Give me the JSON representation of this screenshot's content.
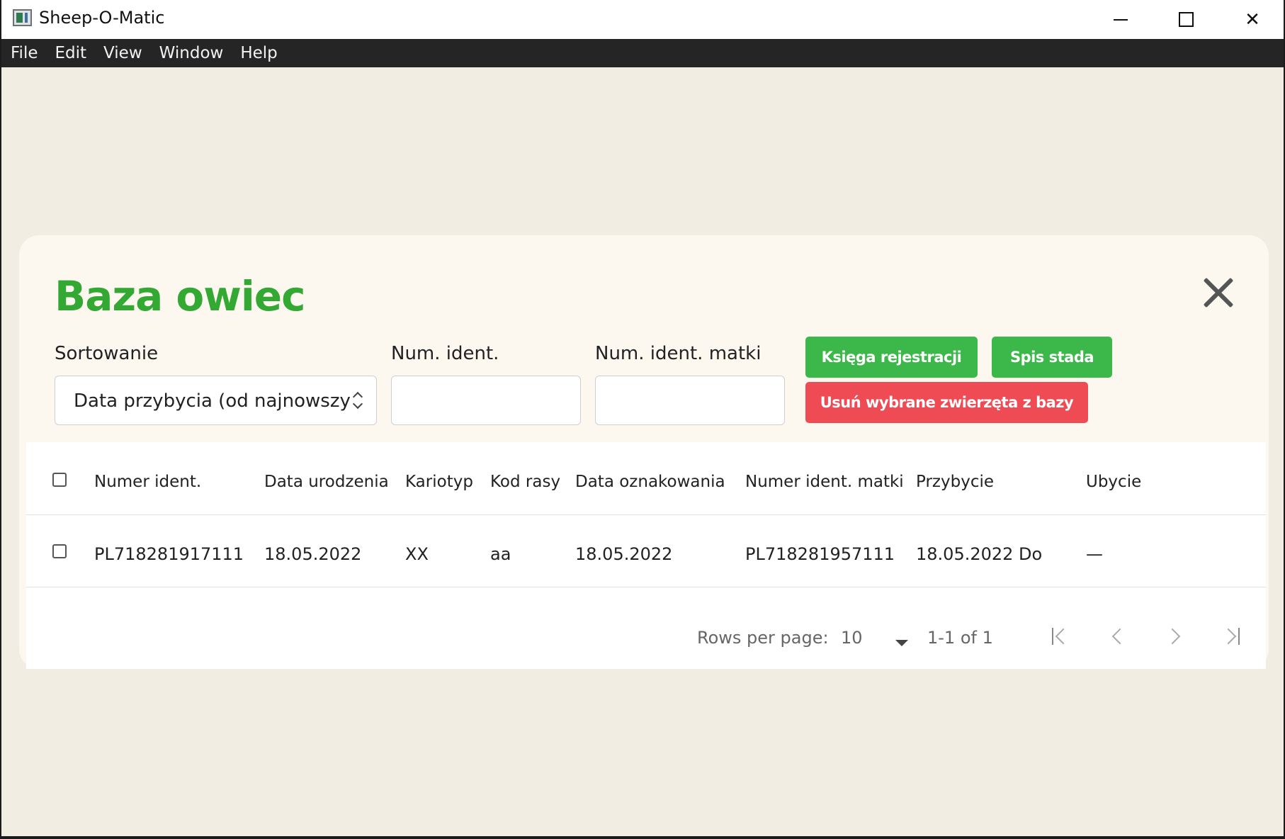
{
  "window": {
    "title": "Sheep-O-Matic",
    "menu": [
      "File",
      "Edit",
      "View",
      "Window",
      "Help"
    ]
  },
  "dialog": {
    "title": "Baza owiec",
    "filters": {
      "sort_label": "Sortowanie",
      "sort_value": "Data przybycia (od najnowszy",
      "id_label": "Num. ident.",
      "id_value": "",
      "mother_id_label": "Num. ident. matki",
      "mother_id_value": ""
    },
    "buttons": {
      "registry": "Księga rejestracji",
      "inventory": "Spis stada",
      "delete_selected": "Usuń wybrane zwierzęta z bazy"
    },
    "table": {
      "columns": [
        "Numer ident.",
        "Data urodzenia",
        "Kariotyp",
        "Kod rasy",
        "Data oznakowania",
        "Numer ident. matki",
        "Przybycie",
        "Ubycie"
      ],
      "rows": [
        [
          "PL718281917111",
          "18.05.2022",
          "XX",
          "aa",
          "18.05.2022",
          "PL718281957111",
          "18.05.2022 Do",
          "—"
        ]
      ]
    },
    "pagination": {
      "rows_per_page_label": "Rows per page:",
      "rows_per_page": "10",
      "range": "1-1 of 1"
    }
  },
  "colors": {
    "title_green": "#33a833",
    "button_green": "#3cb84a",
    "button_red": "#ee4b55",
    "window_bg": "#f2ede2",
    "card_bg": "#fcf8f0"
  }
}
